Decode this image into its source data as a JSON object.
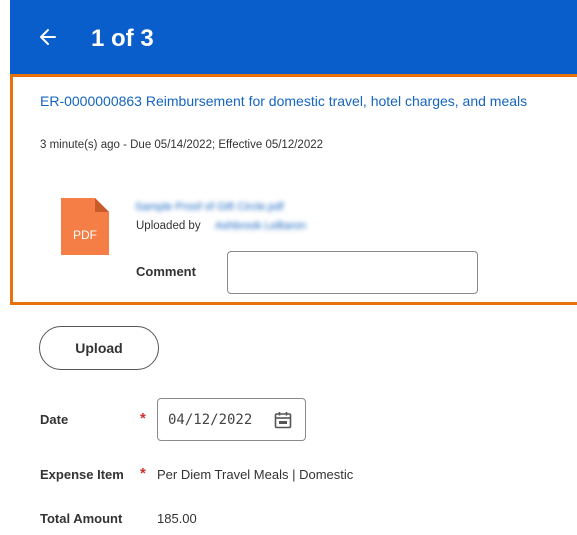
{
  "header": {
    "back_icon": "arrow-left-icon",
    "title": "1 of 3",
    "background": "#0a5ecb"
  },
  "highlight_color": "#e8710a",
  "task": {
    "title": "ER-0000000863 Reimbursement for domestic travel, hotel charges, and meals",
    "meta": "3 minute(s) ago - Due 05/14/2022; Effective 05/12/2022"
  },
  "attachment": {
    "icon": "pdf-file-icon",
    "file_type_label": "PDF",
    "file_name": "Sample Proof of Gift Circle.pdf",
    "uploaded_by_label": "Uploaded by",
    "uploaded_by_name": "Ashbrook LeBaron"
  },
  "comment": {
    "label": "Comment",
    "value": ""
  },
  "upload_button": {
    "label": "Upload"
  },
  "fields": {
    "date": {
      "label": "Date",
      "required_marker": "*",
      "value": "04/12/2022",
      "icon": "calendar-icon"
    },
    "expense_item": {
      "label": "Expense Item",
      "required_marker": "*",
      "value": "Per Diem Travel Meals | Domestic"
    },
    "total_amount": {
      "label": "Total Amount",
      "value": "185.00"
    }
  }
}
